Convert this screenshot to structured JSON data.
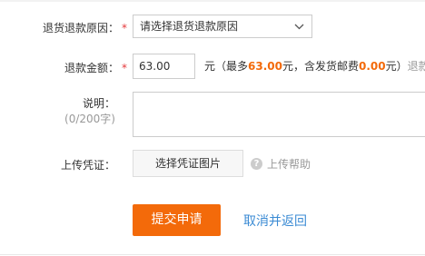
{
  "form": {
    "reason": {
      "label": "退货退款原因：",
      "required_mark": "*",
      "selected": "请选择退货退款原因",
      "chevron_icon": "chevron-down-icon"
    },
    "amount": {
      "label": "退款金额：",
      "required_mark": "*",
      "value": "63.00",
      "note_prefix": "元（最多",
      "max_amount": "63.00",
      "note_mid": "元，含发货邮费",
      "shipping_fee": "0.00",
      "note_suffix": "元）",
      "note_cut": "退款",
      "accent_color": "#f36a0a"
    },
    "description": {
      "label": "说明：",
      "hint": "(0/200字)",
      "value": ""
    },
    "upload": {
      "label": "上传凭证：",
      "button_label": "选择凭证图片",
      "help_icon": "question-circle-icon",
      "help_label": "上传帮助"
    },
    "actions": {
      "submit_label": "提交申请",
      "cancel_label": "取消并返回"
    }
  }
}
